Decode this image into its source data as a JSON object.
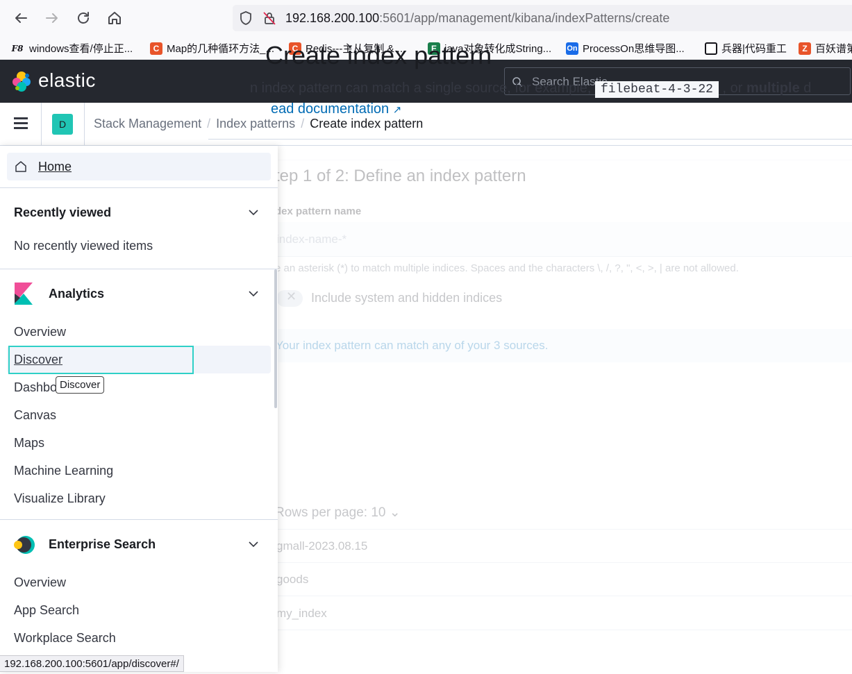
{
  "browser": {
    "url_host": "192.168.200.100",
    "url_rest": ":5601/app/management/kibana/indexPatterns/create",
    "bookmarks": [
      {
        "label": "windows查看/停止正...",
        "icon": "F8",
        "color": "#ffffff"
      },
      {
        "label": "Map的几种循环方法_...",
        "icon": "C",
        "color": "#e8542a"
      },
      {
        "label": "Redis---主从复制 & ...",
        "icon": "C",
        "color": "#e8542a"
      },
      {
        "label": "java对象转化成String...",
        "icon": "E",
        "color": "#1a7f4b"
      },
      {
        "label": "ProcessOn思维导图...",
        "icon": "On",
        "color": "#1a6ce8"
      },
      {
        "label": "兵器|代码重工",
        "icon": "▢",
        "color": "#15141a"
      },
      {
        "label": "百妖谱第",
        "icon": "Z",
        "color": "#e8542a"
      }
    ]
  },
  "header": {
    "logo": "elastic",
    "search_placeholder": "Search Elastic"
  },
  "subheader": {
    "space_initial": "D",
    "breadcrumbs": [
      "Stack Management",
      "Index patterns",
      "Create index pattern"
    ]
  },
  "content": {
    "title": "Create index pattern",
    "desc_pre": "n index pattern can match a single source, for example,",
    "desc_code": "filebeat-4-3-22",
    "desc_post": ", or",
    "desc_bold": "multiple",
    "desc_tail": "d",
    "doc_link": "ead documentation",
    "step": "tep 1 of 2: Define an index pattern",
    "field_label": "dex pattern name",
    "field_placeholder": "index-name-*",
    "help": "e an asterisk (*) to match multiple indices. Spaces and the characters \\, /, ?, \", <, >, | are not allowed.",
    "toggle_label": "Include system and hidden indices",
    "callout": "Your index pattern can match any of your 3 sources.",
    "sources": [
      "gmall-2023.08.15",
      "goods",
      "my_index"
    ],
    "rows_per_page": "Rows per page: 10"
  },
  "nav": {
    "home": "Home",
    "recent_title": "Recently viewed",
    "recent_empty": "No recently viewed items",
    "analytics_title": "Analytics",
    "analytics_items": [
      "Overview",
      "Discover",
      "Dashboard",
      "Canvas",
      "Maps",
      "Machine Learning",
      "Visualize Library"
    ],
    "enterprise_title": "Enterprise Search",
    "enterprise_items": [
      "Overview",
      "App Search",
      "Workplace Search"
    ],
    "tooltip": "Discover"
  },
  "status_url": "192.168.200.100:5601/app/discover#/"
}
